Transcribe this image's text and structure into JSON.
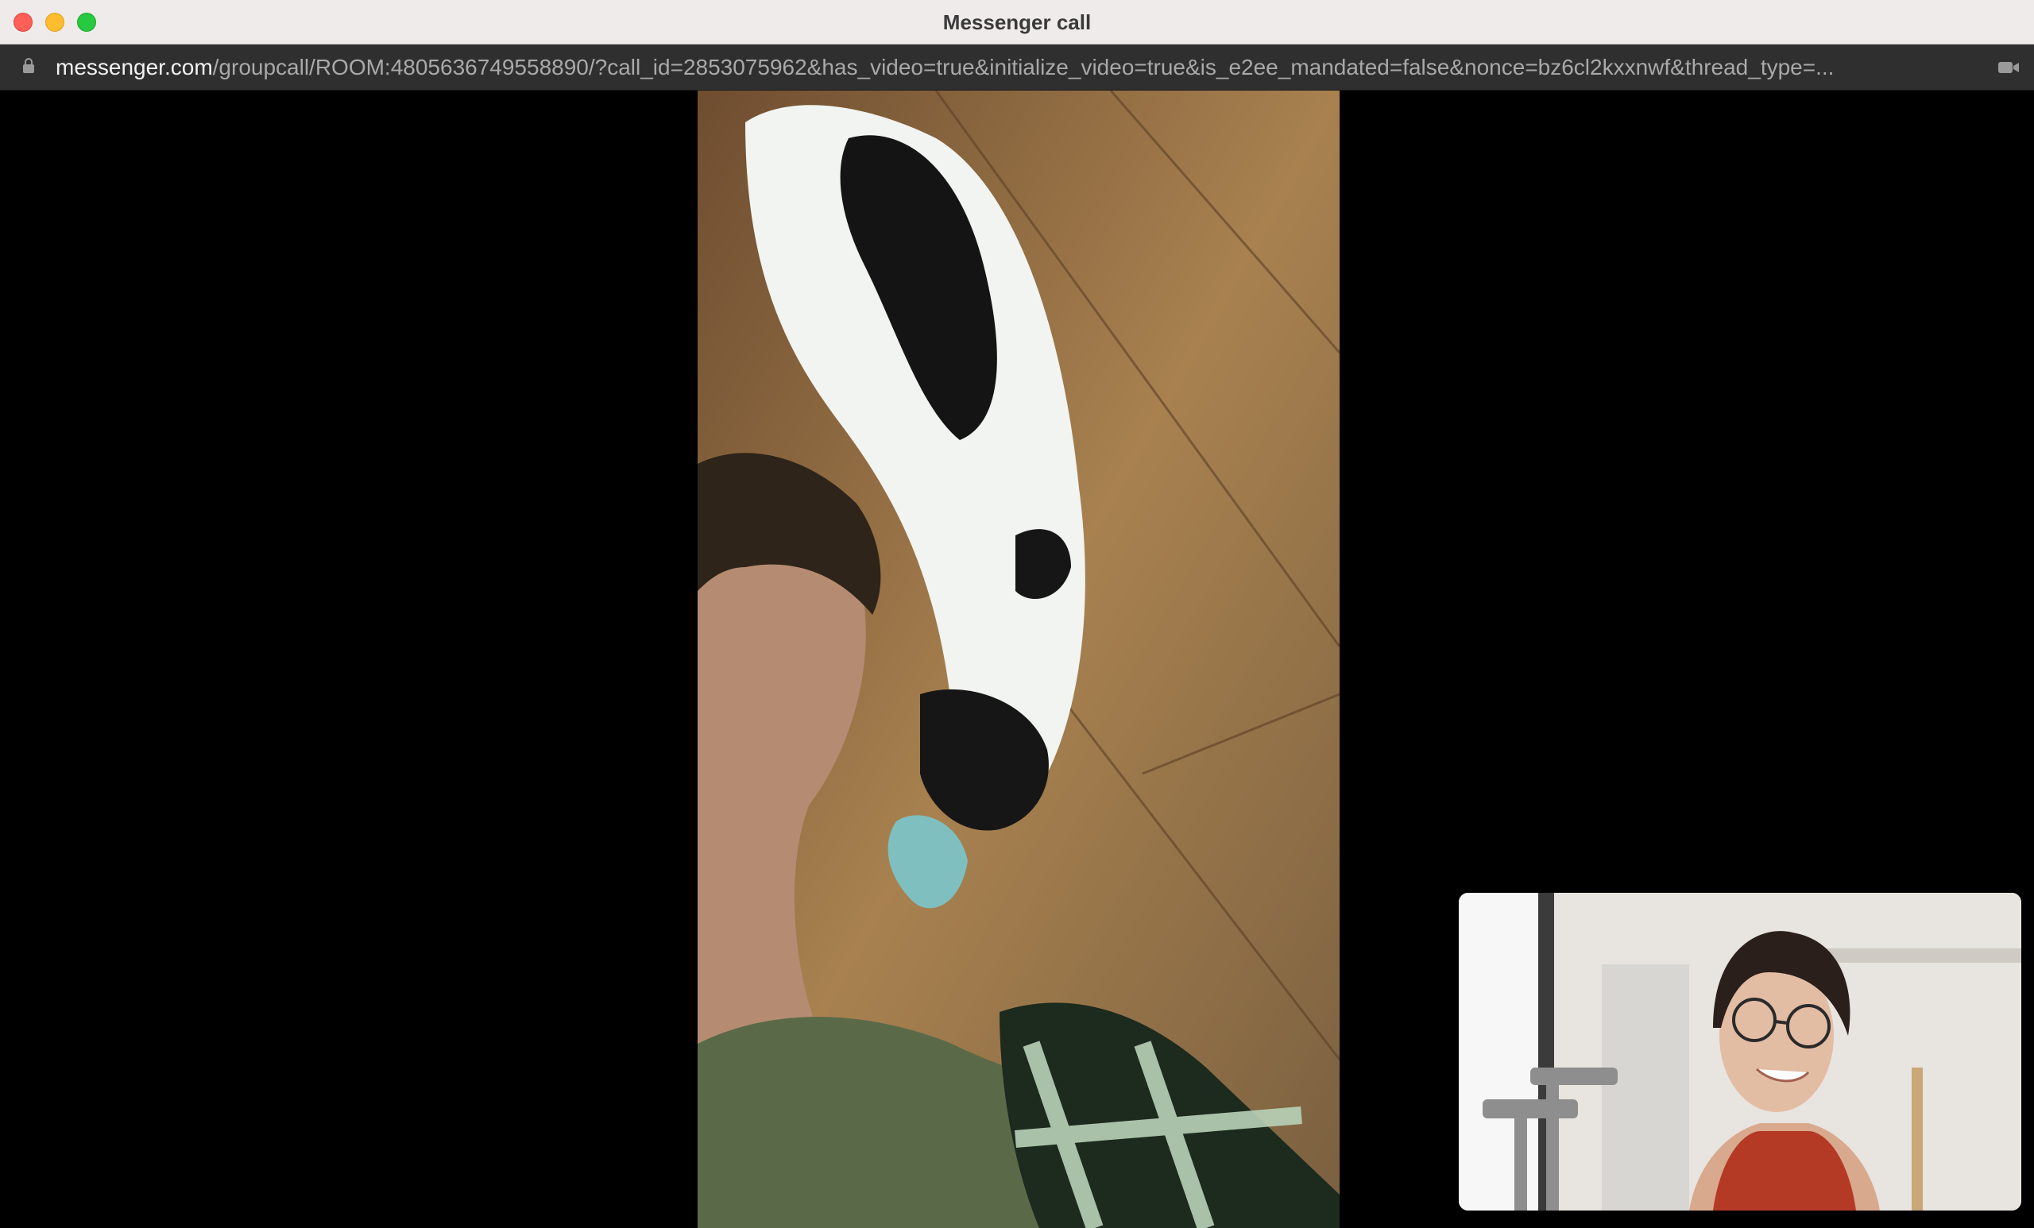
{
  "window": {
    "title": "Messenger call"
  },
  "address_bar": {
    "url_host": "messenger.com",
    "url_path": "/groupcall/ROOM:4805636749558890/?call_id=2853075962&has_video=true&initialize_video=true&is_e2ee_mandated=false&nonce=bz6cl2kxxnwf&thread_type=..."
  },
  "icons": {
    "lock": "lock-icon",
    "camera": "video-camera-icon"
  },
  "call": {
    "remote_participant_video": "remote-video",
    "self_view_video": "self-view-video"
  },
  "colors": {
    "close": "#fe5f57",
    "minimize": "#febc2e",
    "maximize": "#28c840",
    "address_bg": "#2f2f2f"
  }
}
